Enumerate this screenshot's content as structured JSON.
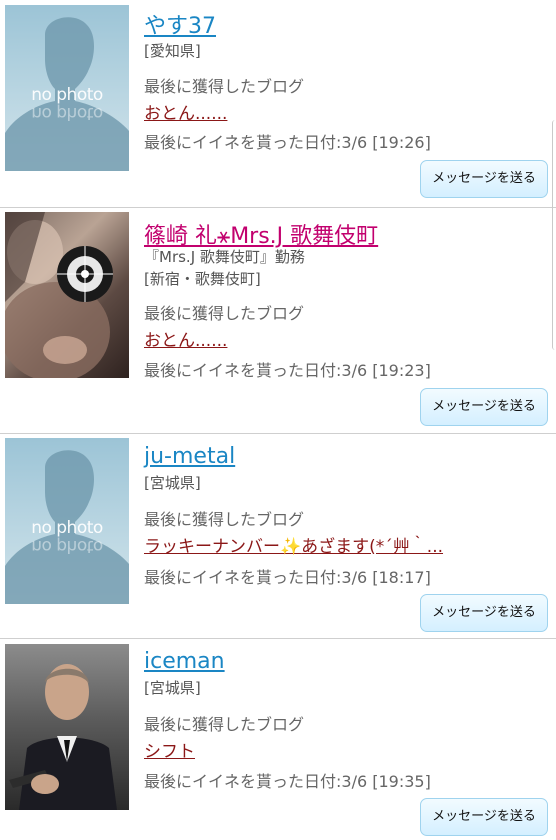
{
  "users": [
    {
      "name": "やす37",
      "name_color": "blue",
      "photo": "no-photo",
      "photo_text": "no photo",
      "shop": "",
      "location": "[愛知県]",
      "blog_label": "最後に獲得したブログ",
      "blog_title": "おとん......",
      "date_text": "最後にイイネを貰った日付:3/6 [19:26]",
      "button": "メッセージを送る"
    },
    {
      "name": "篠崎 礼⚹Mrs.J 歌舞伎町",
      "name_color": "pink",
      "photo": "user-photo",
      "shop": "『Mrs.J 歌舞伎町』勤務",
      "location": "[新宿・歌舞伎町]",
      "blog_label": "最後に獲得したブログ",
      "blog_title": "おとん......",
      "date_text": "最後にイイネを貰った日付:3/6 [19:23]",
      "button": "メッセージを送る"
    },
    {
      "name": "ju-metal",
      "name_color": "blue",
      "photo": "no-photo",
      "photo_text": "no photo",
      "shop": "",
      "location": "[宮城県]",
      "blog_label": "最後に獲得したブログ",
      "blog_title_a": "ラッキーナンバー",
      "blog_title_sparkle": "✨",
      "blog_title_b": "あざます(*´艸｀...",
      "date_text": "最後にイイネを貰った日付:3/6 [18:17]",
      "button": "メッセージを送る"
    },
    {
      "name": "iceman",
      "name_color": "blue",
      "photo": "user-photo",
      "shop": "",
      "location": "[宮城県]",
      "blog_label": "最後に獲得したブログ",
      "blog_title": "シフト",
      "date_text": "最後にイイネを貰った日付:3/6 [19:35]",
      "button": "メッセージを送る"
    }
  ]
}
